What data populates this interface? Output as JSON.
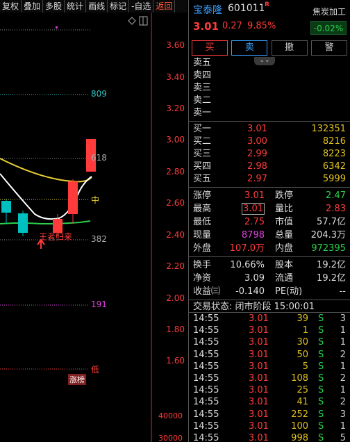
{
  "toolbar": [
    "复权",
    "叠加",
    "多股",
    "统计",
    "画线",
    "标记",
    "-自选",
    "返回"
  ],
  "chart": {
    "price_axis": [
      "3.60",
      "3.40",
      "3.20",
      "3.00",
      "2.80",
      "2.60",
      "2.40",
      "2.20",
      "2.00",
      "1.80",
      "1.60"
    ],
    "volume_axis": [
      "40000",
      "30000"
    ],
    "levels": {
      "l809": "809",
      "l618": "618",
      "mid": "中",
      "l382": "382",
      "l191": "191",
      "low": "低"
    },
    "annotation": "王者归来",
    "limit_tag": "涨榜",
    "colors": {
      "up": "#ff3b3b",
      "down": "#00c0c0",
      "ma1": "#ffffff",
      "ma2": "#e8d030",
      "ma3": "#2ad04a"
    }
  },
  "header": {
    "name": "宝泰隆",
    "code": "601011",
    "badge": "R",
    "price": "3.01",
    "change": "0.27",
    "change_pct": "9.85%",
    "sector": "焦炭加工",
    "sector_pct": "-0.02%"
  },
  "actions": {
    "buy": "买",
    "sell": "卖",
    "cancel": "撤",
    "alert": "警"
  },
  "asks": [
    {
      "label": "卖五",
      "price": "",
      "vol": ""
    },
    {
      "label": "卖四",
      "price": "",
      "vol": ""
    },
    {
      "label": "卖三",
      "price": "",
      "vol": ""
    },
    {
      "label": "卖二",
      "price": "",
      "vol": ""
    },
    {
      "label": "卖一",
      "price": "",
      "vol": ""
    }
  ],
  "bids": [
    {
      "label": "买一",
      "price": "3.01",
      "vol": "132351"
    },
    {
      "label": "买二",
      "price": "3.00",
      "vol": "8216"
    },
    {
      "label": "买三",
      "price": "2.99",
      "vol": "8223"
    },
    {
      "label": "买四",
      "price": "2.98",
      "vol": "6342"
    },
    {
      "label": "买五",
      "price": "2.97",
      "vol": "5999"
    }
  ],
  "quote": {
    "limit_up_l": "涨停",
    "limit_up": "3.01",
    "limit_down_l": "跌停",
    "limit_down": "2.47",
    "high_l": "最高",
    "high": "3.01",
    "vol_ratio_l": "量比",
    "vol_ratio": "2.83",
    "low_l": "最低",
    "low": "2.75",
    "mcap_l": "市值",
    "mcap": "57.7亿",
    "cur_l": "现量",
    "cur": "8798",
    "total_l": "总量",
    "total": "204.3万",
    "outer_l": "外盘",
    "outer": "107.0万",
    "inner_l": "内盘",
    "inner": "972395",
    "turnover_l": "换手",
    "turnover": "10.66%",
    "capital_l": "股本",
    "capital": "19.2亿",
    "nav_l": "净资",
    "nav": "3.09",
    "float_l": "流通",
    "float": "19.2亿",
    "eps_l": "收益㈢",
    "eps": "-0.140",
    "pe_l": "PE(动)",
    "pe": "--"
  },
  "trade_status": "交易状态: 闭市阶段 15:00:01",
  "ticks": [
    {
      "time": "14:55",
      "price": "3.01",
      "vol": "39",
      "bs": "S",
      "n": "3"
    },
    {
      "time": "14:55",
      "price": "3.01",
      "vol": "1",
      "bs": "S",
      "n": "1"
    },
    {
      "time": "14:55",
      "price": "3.01",
      "vol": "30",
      "bs": "S",
      "n": "1"
    },
    {
      "time": "14:55",
      "price": "3.01",
      "vol": "50",
      "bs": "S",
      "n": "2"
    },
    {
      "time": "14:55",
      "price": "3.01",
      "vol": "5",
      "bs": "S",
      "n": "1"
    },
    {
      "time": "14:55",
      "price": "3.01",
      "vol": "108",
      "bs": "S",
      "n": "2"
    },
    {
      "time": "14:55",
      "price": "3.01",
      "vol": "25",
      "bs": "S",
      "n": "1"
    },
    {
      "time": "14:55",
      "price": "3.01",
      "vol": "41",
      "bs": "S",
      "n": "2"
    },
    {
      "time": "14:55",
      "price": "3.01",
      "vol": "252",
      "bs": "S",
      "n": "3"
    },
    {
      "time": "14:55",
      "price": "3.01",
      "vol": "100",
      "bs": "S",
      "n": "1"
    },
    {
      "time": "14:55",
      "price": "3.01",
      "vol": "998",
      "bs": "S",
      "n": "5"
    }
  ]
}
